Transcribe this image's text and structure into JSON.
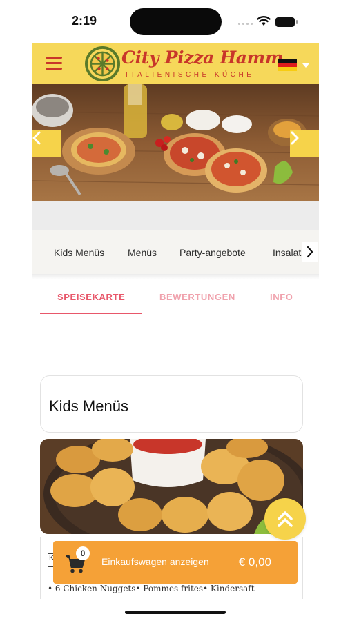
{
  "status_bar": {
    "time": "2:19"
  },
  "header": {
    "logo_name": "City Pizza Hamm",
    "logo_subtitle": "ITALIENISCHE KÜCHE",
    "menu_icon": "hamburger-menu-icon",
    "language_flag": "germany-flag-icon",
    "brand_red": "#c8362a",
    "header_yellow": "#f6d85a"
  },
  "hero": {
    "prev_icon": "chevron-left-icon",
    "next_icon": "chevron-right-icon"
  },
  "categories": {
    "items": [
      "Kids Menüs",
      "Menüs",
      "Party-angebote",
      "Insalat"
    ],
    "scroll_icon": "chevron-right-icon"
  },
  "tabs": {
    "items": [
      "SPEISEKARTE",
      "BEWERTUNGEN",
      "INFO"
    ],
    "active": "SPEISEKARTE",
    "accent": "#e8576a"
  },
  "section": {
    "title": "Kids Menüs"
  },
  "item": {
    "title_fragment": "K",
    "description": "• 6 Chicken Nuggets• Pommes frites• Kindersaft"
  },
  "cart": {
    "count": "0",
    "label": "Einkaufswagen anzeigen",
    "total": "€ 0,00",
    "color": "#f5a137"
  },
  "scroll_top_icon": "double-chevron-up-icon"
}
